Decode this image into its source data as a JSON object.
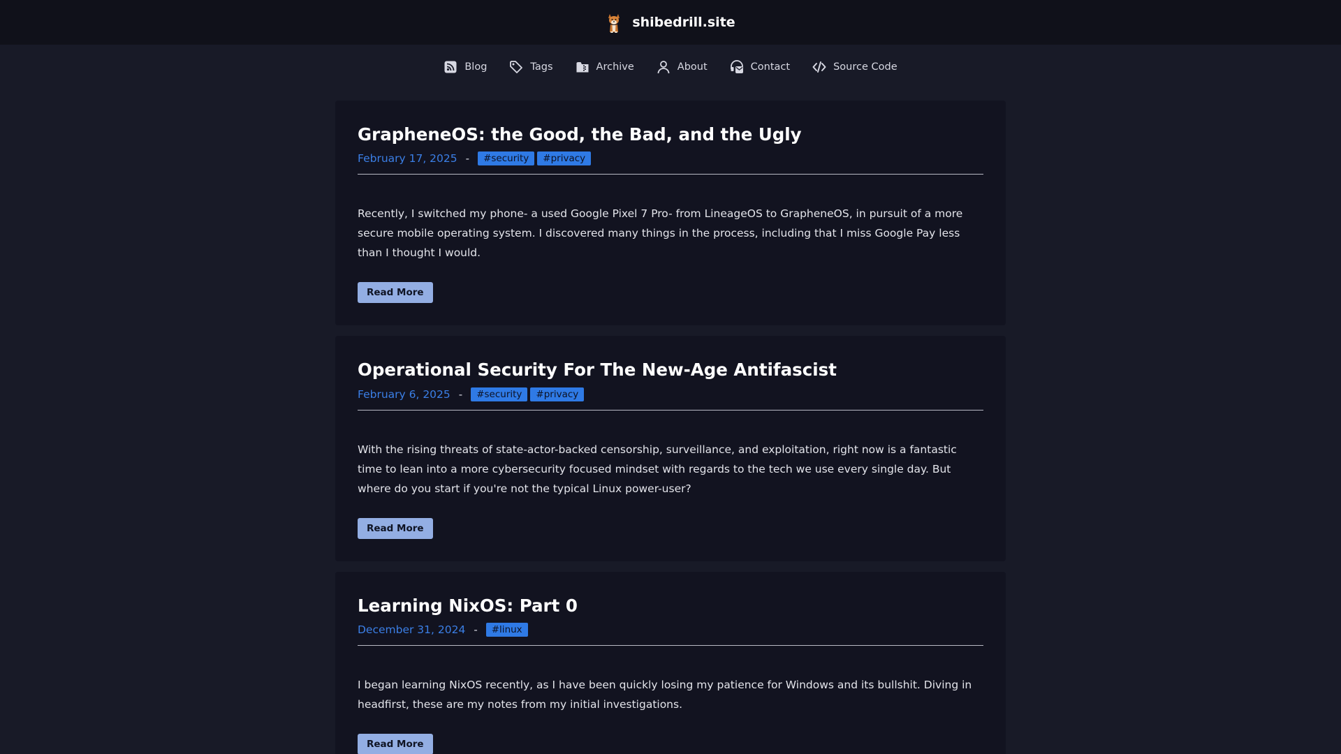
{
  "site": {
    "title": "shibedrill.site",
    "logo_icon": "shiba-dog-icon"
  },
  "nav": {
    "items": [
      {
        "label": "Blog",
        "icon": "rss-icon"
      },
      {
        "label": "Tags",
        "icon": "tag-icon"
      },
      {
        "label": "Archive",
        "icon": "archive-icon"
      },
      {
        "label": "About",
        "icon": "person-icon"
      },
      {
        "label": "Contact",
        "icon": "contact-icon"
      },
      {
        "label": "Source Code",
        "icon": "code-icon"
      }
    ]
  },
  "posts": [
    {
      "title": "GrapheneOS: the Good, the Bad, and the Ugly",
      "date": "February 17, 2025",
      "separator": "-",
      "tags": [
        "#security",
        "#privacy"
      ],
      "excerpt": "Recently, I switched my phone- a used Google Pixel 7 Pro- from LineageOS to GrapheneOS, in pursuit of a more secure mobile operating system. I discovered many things in the process, including that I miss Google Pay less than I thought I would.",
      "button": "Read More"
    },
    {
      "title": "Operational Security For The New-Age Antifascist",
      "date": "February 6, 2025",
      "separator": "-",
      "tags": [
        "#security",
        "#privacy"
      ],
      "excerpt": "With the rising threats of state-actor-backed censorship, surveillance, and exploitation, right now is a fantastic time to lean into a more cybersecurity focused mindset with regards to the tech we use every single day. But where do you start if you're not the typical Linux power-user?",
      "button": "Read More"
    },
    {
      "title": "Learning NixOS: Part 0",
      "date": "December 31, 2024",
      "separator": "-",
      "tags": [
        "#linux"
      ],
      "excerpt": "I began learning NixOS recently, as I have been quickly losing my patience for Windows and its bullshit. Diving in headfirst, these are my notes from my initial investigations.",
      "button": "Read More"
    }
  ],
  "colors": {
    "background": "#181a27",
    "header_background": "#10111a",
    "card_background": "#121320",
    "accent_link": "#3b7fe6",
    "tag_background": "#2f7ae5",
    "button_background": "#93aee3"
  }
}
